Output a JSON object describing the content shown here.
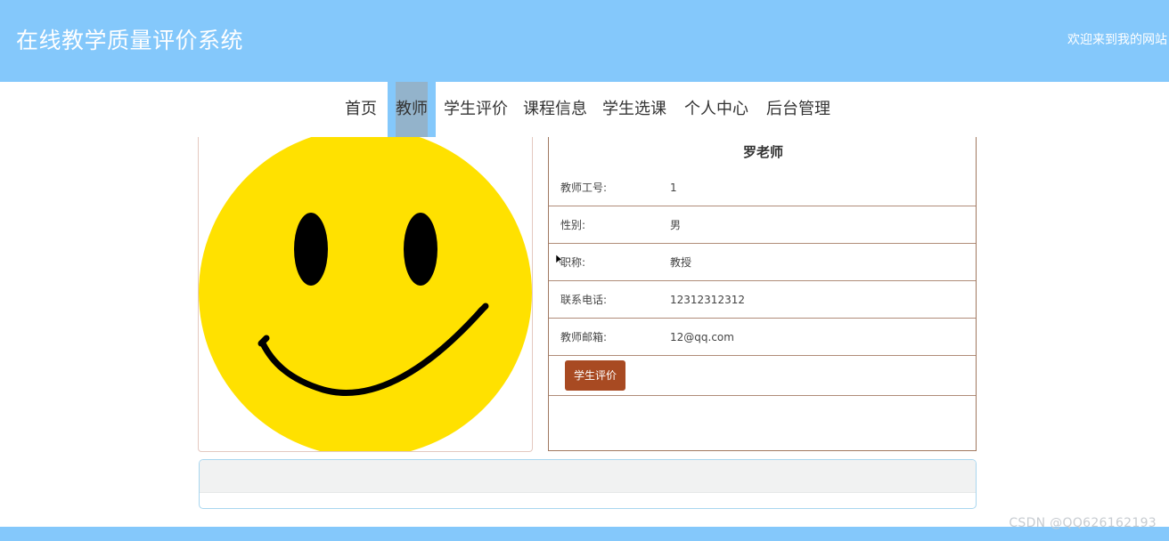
{
  "header": {
    "site_title": "在线教学质量评价系统",
    "welcome": "欢迎来到我的网站"
  },
  "nav": {
    "items": [
      {
        "label": "首页"
      },
      {
        "label": "教师",
        "active": true
      },
      {
        "label": "学生评价"
      },
      {
        "label": "课程信息"
      },
      {
        "label": "学生选课"
      },
      {
        "label": "个人中心"
      },
      {
        "label": "后台管理"
      }
    ]
  },
  "teacher": {
    "name": "罗老师",
    "photo": "smiley-face-icon",
    "fields": [
      {
        "label": "教师工号:",
        "value": "1"
      },
      {
        "label": "性别:",
        "value": "男"
      },
      {
        "label": "职称:",
        "value": "教授"
      },
      {
        "label": "联系电话:",
        "value": "12312312312"
      },
      {
        "label": "教师邮箱:",
        "value": "12@qq.com"
      }
    ],
    "eval_button_label": "学生评价"
  },
  "watermark": "CSDN @QQ626162193",
  "colors": {
    "header_bg": "#84c8fb",
    "nav_active_bg": "#93b3cb",
    "button_bg": "#a84a22",
    "smiley_yellow": "#ffe100"
  }
}
